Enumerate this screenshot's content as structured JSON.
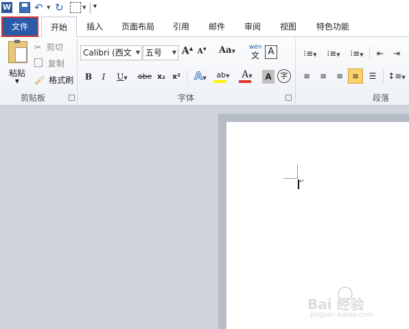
{
  "quick_access": {
    "icons": [
      "word-app-icon",
      "save-icon",
      "undo-icon",
      "redo-icon",
      "quick-print-icon",
      "customize-icon"
    ]
  },
  "tabs": {
    "file": "文件",
    "home": "开始",
    "insert": "插入",
    "layout": "页面布局",
    "references": "引用",
    "mailings": "邮件",
    "review": "审阅",
    "view": "视图",
    "features": "特色功能"
  },
  "clipboard": {
    "paste": "粘贴",
    "cut": "剪切",
    "copy": "复制",
    "format_painter": "格式刷",
    "group_label": "剪贴板"
  },
  "font": {
    "font_name": "Calibri (西文",
    "font_size": "五号",
    "grow": "A",
    "shrink": "A",
    "change_case": "Aa",
    "bold": "B",
    "italic": "I",
    "underline": "U",
    "strikethrough": "abe",
    "subscript": "x₂",
    "superscript": "x²",
    "text_effect": "A",
    "highlight": "ab",
    "font_color": "A",
    "char_shading": "A",
    "enclose": "字",
    "phonetic_top": "wén",
    "phonetic_bottom": "文",
    "char_border": "A",
    "group_label": "字体"
  },
  "paragraph": {
    "group_label": "段落"
  },
  "watermark": {
    "brand": "Bai 经验",
    "url": "jingyan.baidu.com"
  },
  "colors": {
    "file_tab": "#2a5aa8",
    "highlight_outline": "#e0332c",
    "active_align": "#fcd36a"
  }
}
